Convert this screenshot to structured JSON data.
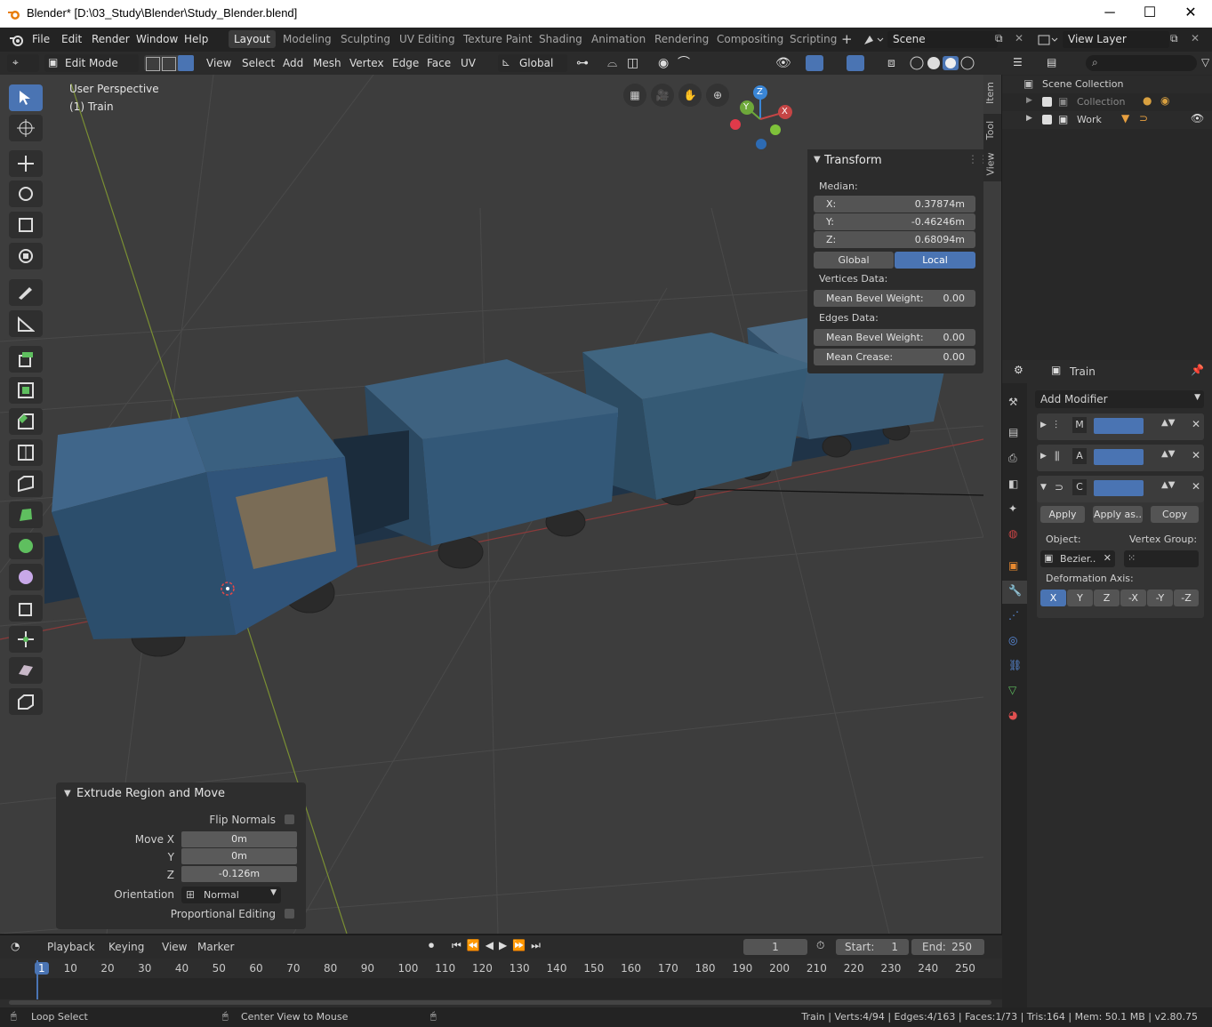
{
  "titlebar": {
    "title": "Blender* [D:\\03_Study\\Blender\\Study_Blender.blend]",
    "minimize": "─",
    "maximize": "☐",
    "close": "✕"
  },
  "menu": [
    "File",
    "Edit",
    "Render",
    "Window",
    "Help"
  ],
  "workspaces": [
    "Layout",
    "Modeling",
    "Sculpting",
    "UV Editing",
    "Texture Paint",
    "Shading",
    "Animation",
    "Rendering",
    "Compositing",
    "Scripting"
  ],
  "scene": "Scene",
  "view_layer": "View Layer",
  "header": {
    "mode": "Edit Mode",
    "menus": [
      "View",
      "Select",
      "Add",
      "Mesh",
      "Vertex",
      "Edge",
      "Face",
      "UV"
    ],
    "orientation": "Global"
  },
  "viewport": {
    "perspective": "User Perspective",
    "object": "(1) Train",
    "gizmo": {
      "z": "Z",
      "y": "Y",
      "x": "X"
    }
  },
  "npanel": {
    "title": "Transform",
    "median": "Median:",
    "x_label": "X:",
    "x": "0.37874m",
    "y_label": "Y:",
    "y": "-0.46246m",
    "z_label": "Z:",
    "z": "0.68094m",
    "global": "Global",
    "local": "Local",
    "vertices_data": "Vertices Data:",
    "v_bevel_label": "Mean Bevel Weight:",
    "v_bevel": "0.00",
    "edges_data": "Edges Data:",
    "e_bevel_label": "Mean Bevel Weight:",
    "e_bevel": "0.00",
    "crease_label": "Mean Crease:",
    "crease": "0.00",
    "tabs": [
      "Item",
      "Tool",
      "View"
    ]
  },
  "outliner": {
    "scene_collection": "Scene Collection",
    "items": [
      "Collection",
      "Work"
    ]
  },
  "properties": {
    "object": "Train",
    "add_modifier": "Add Modifier",
    "modifiers": [
      {
        "letter": "M"
      },
      {
        "letter": "A"
      },
      {
        "letter": "C"
      }
    ],
    "apply": "Apply",
    "apply_as": "Apply as..",
    "copy": "Copy",
    "object_label": "Object:",
    "object_value": "Bezier..",
    "vertex_group_label": "Vertex Group:",
    "deformation_axis": "Deformation Axis:",
    "axes": [
      "X",
      "Y",
      "Z",
      "-X",
      "-Y",
      "-Z"
    ]
  },
  "operator": {
    "title": "Extrude Region and Move",
    "flip_normals": "Flip Normals",
    "move_x_label": "Move X",
    "move_x": "0m",
    "y_label": "Y",
    "y": "0m",
    "z_label": "Z",
    "z": "-0.126m",
    "orientation_label": "Orientation",
    "orientation": "Normal",
    "proportional": "Proportional Editing"
  },
  "timeline": {
    "menus": [
      "Playback",
      "Keying",
      "View",
      "Marker"
    ],
    "current_frame": "1",
    "start_label": "Start:",
    "start": "1",
    "end_label": "End:",
    "end": "250",
    "ticks": [
      "1",
      "10",
      "20",
      "30",
      "40",
      "50",
      "60",
      "70",
      "80",
      "90",
      "100",
      "110",
      "120",
      "130",
      "140",
      "150",
      "160",
      "170",
      "180",
      "190",
      "200",
      "210",
      "220",
      "230",
      "240",
      "250"
    ]
  },
  "statusbar": {
    "left": "Loop Select",
    "mid": "Center View to Mouse",
    "right": "Train | Verts:4/94 | Edges:4/163 | Faces:1/73 | Tris:164 | Mem: 50.1 MB | v2.80.75"
  }
}
